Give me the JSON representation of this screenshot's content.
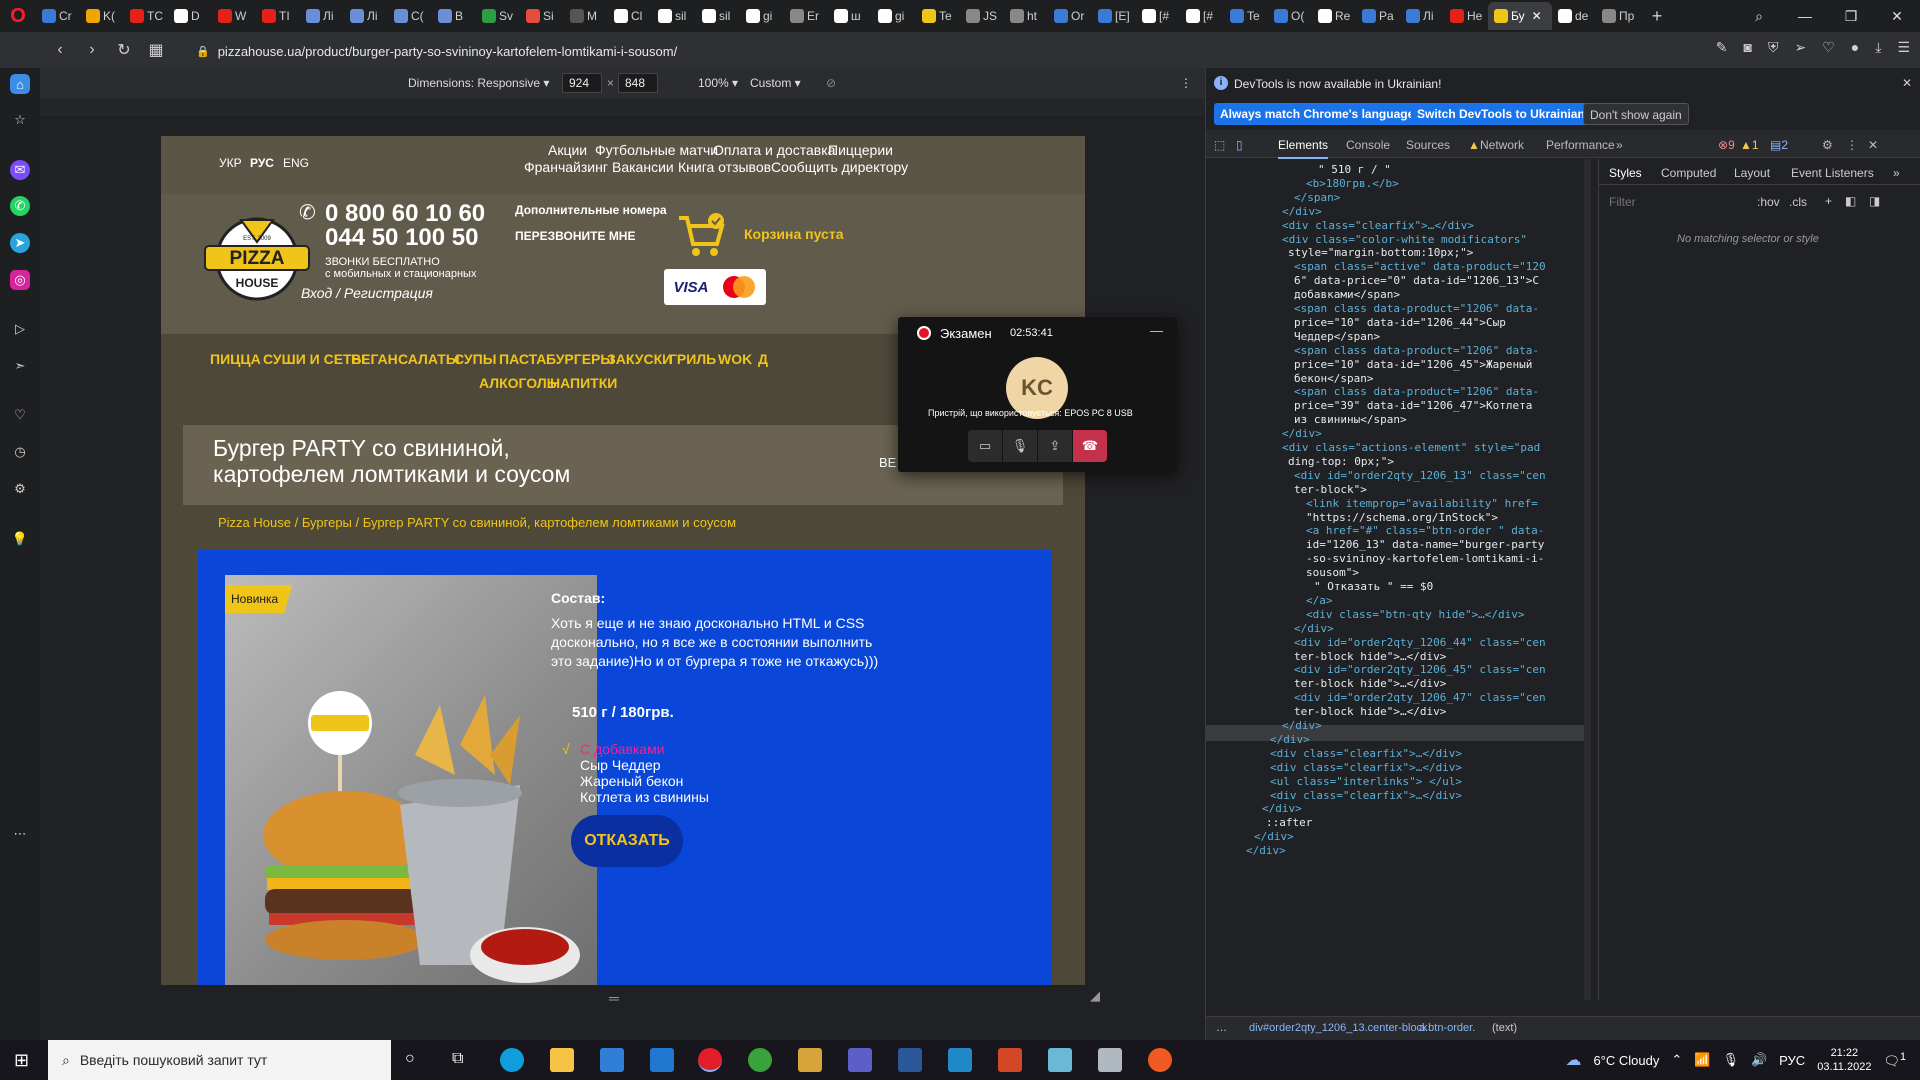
{
  "browser": {
    "tabs": [
      {
        "label": "Cr",
        "color": "#3a7bd5"
      },
      {
        "label": "K(",
        "color": "#f0a500"
      },
      {
        "label": "TC",
        "color": "#e62117"
      },
      {
        "label": "D",
        "color": "#ffffff"
      },
      {
        "label": "W",
        "color": "#e62117"
      },
      {
        "label": "TI",
        "color": "#e62117"
      },
      {
        "label": "Лі",
        "color": "#6a8fd6"
      },
      {
        "label": "Лі",
        "color": "#6a8fd6"
      },
      {
        "label": "C(",
        "color": "#6a8fd6"
      },
      {
        "label": "B",
        "color": "#6a8fd6"
      },
      {
        "label": "Sv",
        "color": "#2e9e44"
      },
      {
        "label": "Si",
        "color": "#e84c3d"
      },
      {
        "label": "M",
        "color": "#555555"
      },
      {
        "label": "Cl",
        "color": "#ffffff"
      },
      {
        "label": "sil",
        "color": "#ffffff"
      },
      {
        "label": "sil",
        "color": "#ffffff"
      },
      {
        "label": "gi",
        "color": "#ffffff"
      },
      {
        "label": "Er",
        "color": "#888888"
      },
      {
        "label": "ш",
        "color": "#ffffff"
      },
      {
        "label": "gi",
        "color": "#ffffff"
      },
      {
        "label": "Te",
        "color": "#f0c419"
      },
      {
        "label": "JS",
        "color": "#888888"
      },
      {
        "label": "ht",
        "color": "#888888"
      },
      {
        "label": "Or",
        "color": "#3a7bd5"
      },
      {
        "label": "[E]",
        "color": "#3a7bd5"
      },
      {
        "label": "[#",
        "color": "#ffffff"
      },
      {
        "label": "[#",
        "color": "#ffffff"
      },
      {
        "label": "Te",
        "color": "#3a7bd5"
      },
      {
        "label": "O(",
        "color": "#3a7bd5"
      },
      {
        "label": "Re",
        "color": "#ffffff"
      },
      {
        "label": "Pa",
        "color": "#3a7bd5"
      },
      {
        "label": "Лі",
        "color": "#3a7bd5"
      },
      {
        "label": "He",
        "color": "#e62117"
      },
      {
        "label": "Бу",
        "color": "#f0c419",
        "active": true
      },
      {
        "label": "de",
        "color": "#ffffff"
      },
      {
        "label": "Пр",
        "color": "#888888"
      }
    ],
    "url": "pizzahouse.ua/product/burger-party-so-svininoy-kartofelem-lomtikami-i-sousom/"
  },
  "device_toolbar": {
    "dimensions_label": "Dimensions: Responsive",
    "width": "924",
    "height": "848",
    "times": "×",
    "zoom": "100%",
    "throttle": "Custom"
  },
  "site": {
    "langs": [
      "УКР",
      "РУС",
      "ENG"
    ],
    "topnav_row1": [
      "Акции",
      "Футбольные матчи",
      "Оплата и доставка",
      "Пиццерии"
    ],
    "topnav_row2": [
      "Франчайзинг",
      "Вакансии",
      "Книга отзывов",
      "Сообщить директору"
    ],
    "phone1": "0 800 60 10 60",
    "phone2": "044 50 100 50",
    "free_calls_1": "ЗВОНКИ БЕСПЛАТНО",
    "free_calls_2": "с мобильных и стационарных",
    "extra_numbers": "Дополнительные номера",
    "callback": "ПЕРЕЗВОНИТЕ МНЕ",
    "cart": "Корзина пуста",
    "login": "Вход / Регистрация",
    "logo_text": "PIZZA",
    "logo_sub": "HOUSE",
    "logo_est": "EST. 2009",
    "menu_row1": [
      "ПИЦЦА",
      "СУШИ И СЕТЫ",
      "ВЕГАН",
      "САЛАТЫ",
      "СУПЫ",
      "ПАСТА",
      "БУРГЕРЫ",
      "ЗАКУСКИ",
      "ГРИЛЬ",
      "WOK",
      "Д"
    ],
    "menu_row2": [
      "АЛКОГОЛЬ",
      "НАПИТКИ"
    ],
    "product_title_1": "Бургер PARTY со свининой,",
    "product_title_2": "картофелем ломтиками и соусом",
    "title_right": "ВЕ",
    "breadcrumb": "Pizza House / Бургеры / Бургер PARTY со свининой, картофелем ломтиками и соусом",
    "badge": "Новинка",
    "composition_title": "Состав:",
    "composition_text": "Хоть я еще и не знаю досконально HTML и CSS досконально, но я все же в состоянии выполнить это задание)Но и от бургера я тоже не откажусь)))",
    "price": "510 г / 180грв.",
    "options": [
      {
        "label": "С добавками",
        "active": true
      },
      {
        "label": "Сыр Чеддер",
        "active": false
      },
      {
        "label": "Жареный бекон",
        "active": false
      },
      {
        "label": "Котлета из свинины",
        "active": false
      }
    ],
    "check": "√",
    "cancel_button": "ОТКАЗАТЬ"
  },
  "call": {
    "title": "Экзамен",
    "time": "02:53:41",
    "avatar": "KC",
    "device_note": "Пристрій, що використовується: EPOS PC 8 USB"
  },
  "devtools": {
    "banner_text": "DevTools is now available in Ukrainian!",
    "btn_match": "Always match Chrome's language",
    "btn_switch": "Switch DevTools to Ukrainian",
    "btn_dont": "Don't show again",
    "tabs": [
      "Elements",
      "Console",
      "Sources",
      "Network",
      "Performance"
    ],
    "errors": "9",
    "warnings": "1",
    "messages": "2",
    "styles_tabs": [
      "Styles",
      "Computed",
      "Layout",
      "Event Listeners"
    ],
    "filter_placeholder": "Filter",
    "hov": ":hov",
    "cls": ".cls",
    "no_match": "No matching selector or style",
    "breadcrumb_path": "div#order2qty_1206_13.center-block",
    "breadcrumb_a": "a.btn-order.",
    "breadcrumb_text": "(text)",
    "code_lines": [
      "\" 510 г / \"",
      "<b>180грв.</b>",
      "</span>",
      "</div>",
      "<div class=\"clearfix\">…</div>",
      "<div class=\"color-white modificators\"",
      "style=\"margin-bottom:10px;\">",
      "<span class=\"active\" data-product=\"120",
      "6\" data-price=\"0\" data-id=\"1206_13\">С",
      "добавками</span>",
      "<span class data-product=\"1206\" data-",
      "price=\"10\" data-id=\"1206_44\">Сыр",
      "Чеддер</span>",
      "<span class data-product=\"1206\" data-",
      "price=\"10\" data-id=\"1206_45\">Жареный",
      "бекон</span>",
      "<span class data-product=\"1206\" data-",
      "price=\"39\" data-id=\"1206_47\">Котлета",
      "из свинины</span>",
      "</div>",
      "<div class=\"actions-element\" style=\"pad",
      "ding-top: 0px;\">",
      "<div id=\"order2qty_1206_13\" class=\"cen",
      "ter-block\">",
      "<link itemprop=\"availability\" href=",
      "\"https://schema.org/InStock\">",
      "<a href=\"#\" class=\"btn-order \" data-",
      "id=\"1206_13\" data-name=\"burger-party",
      "-so-svininoy-kartofelem-lomtikami-i-",
      "sousom\">",
      "\" Отказать \" == $0",
      "</a>",
      "<div class=\"btn-qty hide\">…</div>",
      "</div>",
      "<div id=\"order2qty_1206_44\" class=\"cen",
      "ter-block hide\">…</div>",
      "<div id=\"order2qty_1206_45\" class=\"cen",
      "ter-block hide\">…</div>",
      "<div id=\"order2qty_1206_47\" class=\"cen",
      "ter-block hide\">…</div>",
      "</div>",
      "</div>",
      "<div class=\"clearfix\">…</div>",
      "<div class=\"clearfix\">…</div>",
      "<ul class=\"interlinks\"> </ul>",
      "<div class=\"clearfix\">…</div>",
      "</div>",
      "::after",
      "</div>",
      "</div>"
    ]
  },
  "taskbar": {
    "search_placeholder": "Введіть пошуковий запит тут",
    "weather": "6°C  Cloudy",
    "lang": "РУС",
    "time": "21:22",
    "date": "03.11.2022",
    "notif_count": "1"
  }
}
